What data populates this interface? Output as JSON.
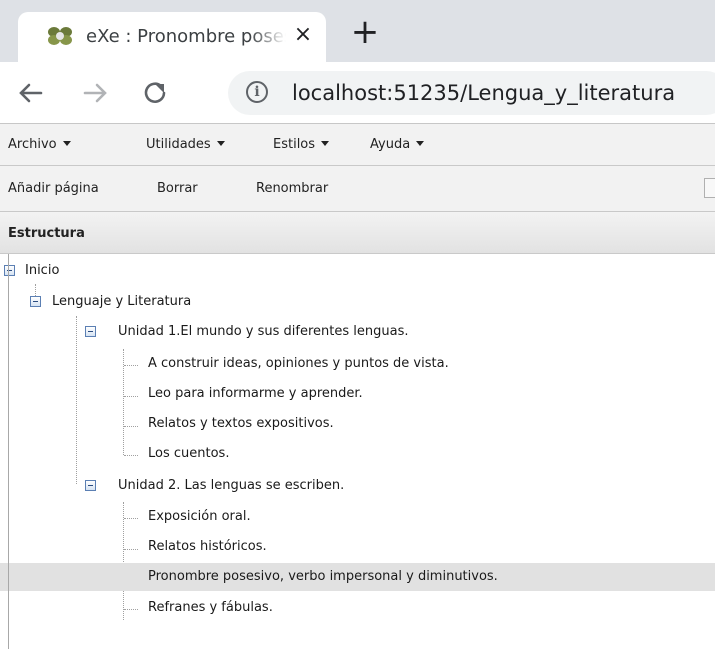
{
  "browser": {
    "tab_title": "eXe : Pronombre posesivo, verbo impersonal y diminutivos",
    "tab_close": "×",
    "new_tab": "+",
    "url": "localhost:51235/Lengua_y_literatura",
    "info": "i"
  },
  "menubar": {
    "items": [
      "Archivo",
      "Utilidades",
      "Estilos",
      "Ayuda"
    ]
  },
  "actions": {
    "items": [
      "Añadir página",
      "Borrar",
      "Renombrar"
    ]
  },
  "panel": {
    "title": "Estructura"
  },
  "tree": {
    "nodes": [
      "Inicio",
      "Lenguaje y Literatura",
      "Unidad 1.El mundo y sus diferentes lenguas.",
      "A construir ideas, opiniones y puntos de vista.",
      "Leo para informarme y aprender.",
      "Relatos y textos expositivos.",
      "Los cuentos.",
      "Unidad 2. Las lenguas se escriben.",
      "Exposición oral.",
      "Relatos históricos.",
      "Pronombre posesivo, verbo impersonal y diminutivos.",
      "Refranes y fábulas."
    ],
    "selected": "Pronombre posesivo, verbo impersonal y diminutivos."
  },
  "colors": {
    "chrome_bg": "#dee1e6",
    "app_bar": "#f2f2f2",
    "selected_row": "#e1e1e1"
  }
}
